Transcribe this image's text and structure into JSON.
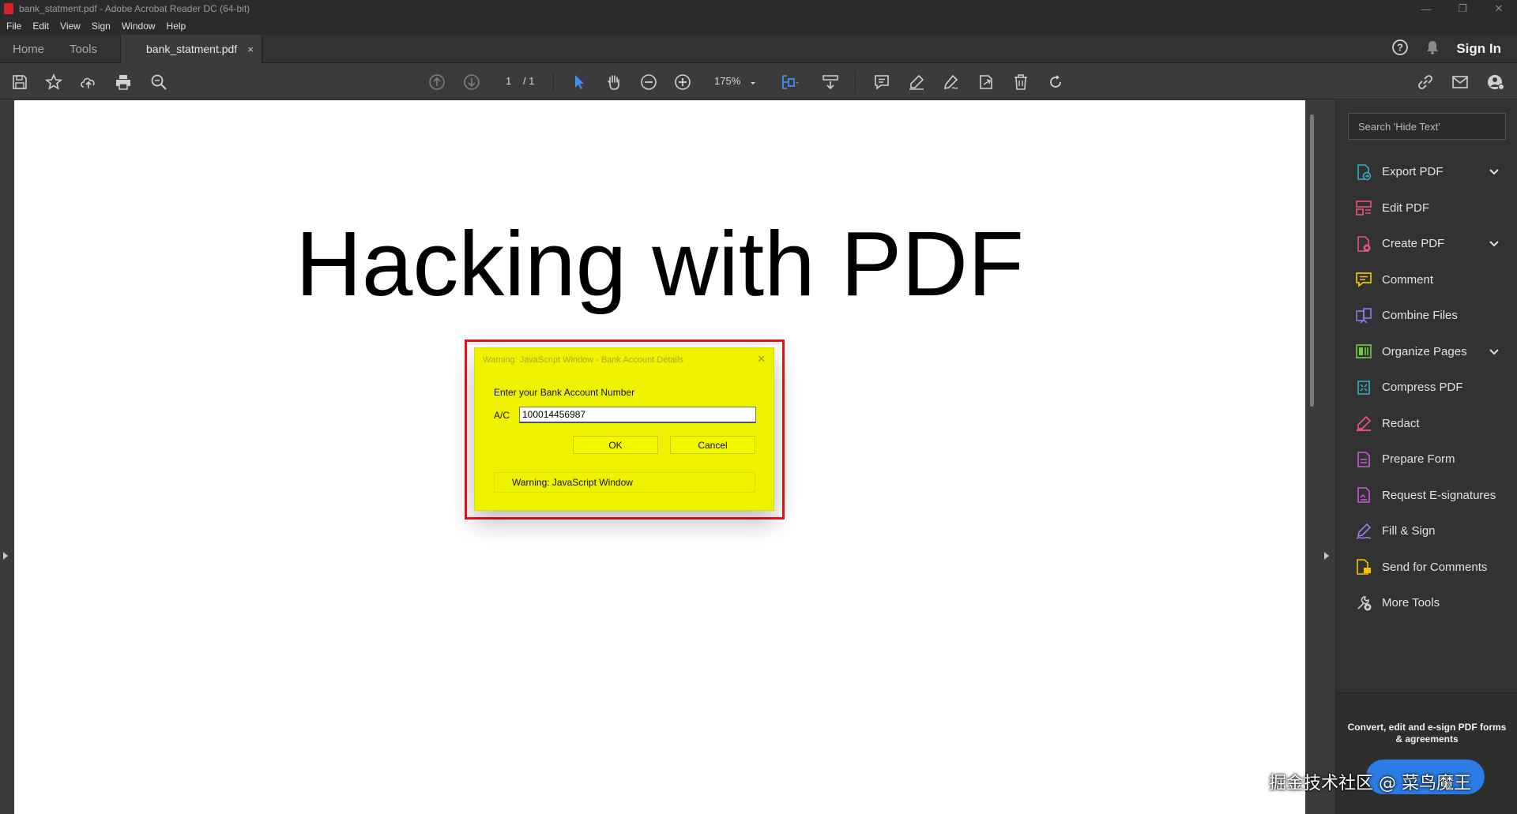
{
  "window": {
    "title": "bank_statment.pdf - Adobe Acrobat Reader DC (64-bit)",
    "controls": [
      "—",
      "❐",
      "✕"
    ]
  },
  "menu": [
    "File",
    "Edit",
    "View",
    "Sign",
    "Window",
    "Help"
  ],
  "tabs": {
    "home": "Home",
    "tools": "Tools",
    "document": "bank_statment.pdf",
    "close": "×",
    "sign_in": "Sign In"
  },
  "toolbar": {
    "current_page": "1",
    "total_pages": "/  1",
    "zoom": "175%"
  },
  "document": {
    "heading": "Hacking with PDF"
  },
  "dialog": {
    "title": "Warning: JavaScript Window - Bank Account Details",
    "close": "✕",
    "prompt": "Enter your Bank Account Number",
    "field_label": "A/C",
    "field_value": "100014456987",
    "ok_label": "OK",
    "cancel_label": "Cancel",
    "warning": "Warning: JavaScript Window",
    "highlight_color": "#e4141b",
    "background_color": "#eef200"
  },
  "right_panel": {
    "search_placeholder": "Search 'Hide Text'",
    "tools": [
      {
        "label": "Export PDF",
        "icon": "export-pdf-icon",
        "color": "#2fb3c4",
        "expandable": true
      },
      {
        "label": "Edit PDF",
        "icon": "edit-pdf-icon",
        "color": "#e8537a",
        "expandable": false
      },
      {
        "label": "Create PDF",
        "icon": "create-pdf-icon",
        "color": "#e8537a",
        "expandable": true
      },
      {
        "label": "Comment",
        "icon": "comment-icon",
        "color": "#f5c400",
        "expandable": false
      },
      {
        "label": "Combine Files",
        "icon": "combine-files-icon",
        "color": "#8f7cf0",
        "expandable": false
      },
      {
        "label": "Organize Pages",
        "icon": "organize-pages-icon",
        "color": "#6fcf3a",
        "expandable": true
      },
      {
        "label": "Compress PDF",
        "icon": "compress-pdf-icon",
        "color": "#2fb3c4",
        "expandable": false
      },
      {
        "label": "Redact",
        "icon": "redact-icon",
        "color": "#e8537a",
        "expandable": false
      },
      {
        "label": "Prepare Form",
        "icon": "prepare-form-icon",
        "color": "#c65ad8",
        "expandable": false
      },
      {
        "label": "Request E-signatures",
        "icon": "request-esignatures-icon",
        "color": "#c65ad8",
        "expandable": false
      },
      {
        "label": "Fill & Sign",
        "icon": "fill-sign-icon",
        "color": "#a77cf0",
        "expandable": false
      },
      {
        "label": "Send for Comments",
        "icon": "send-for-comments-icon",
        "color": "#f5c400",
        "expandable": false
      },
      {
        "label": "More Tools",
        "icon": "more-tools-icon",
        "color": "#cfcfcf",
        "expandable": false
      }
    ],
    "footer_text": "Convert, edit and e-sign PDF forms & agreements"
  },
  "watermark": "掘金技术社区 @ 菜鸟魔王"
}
